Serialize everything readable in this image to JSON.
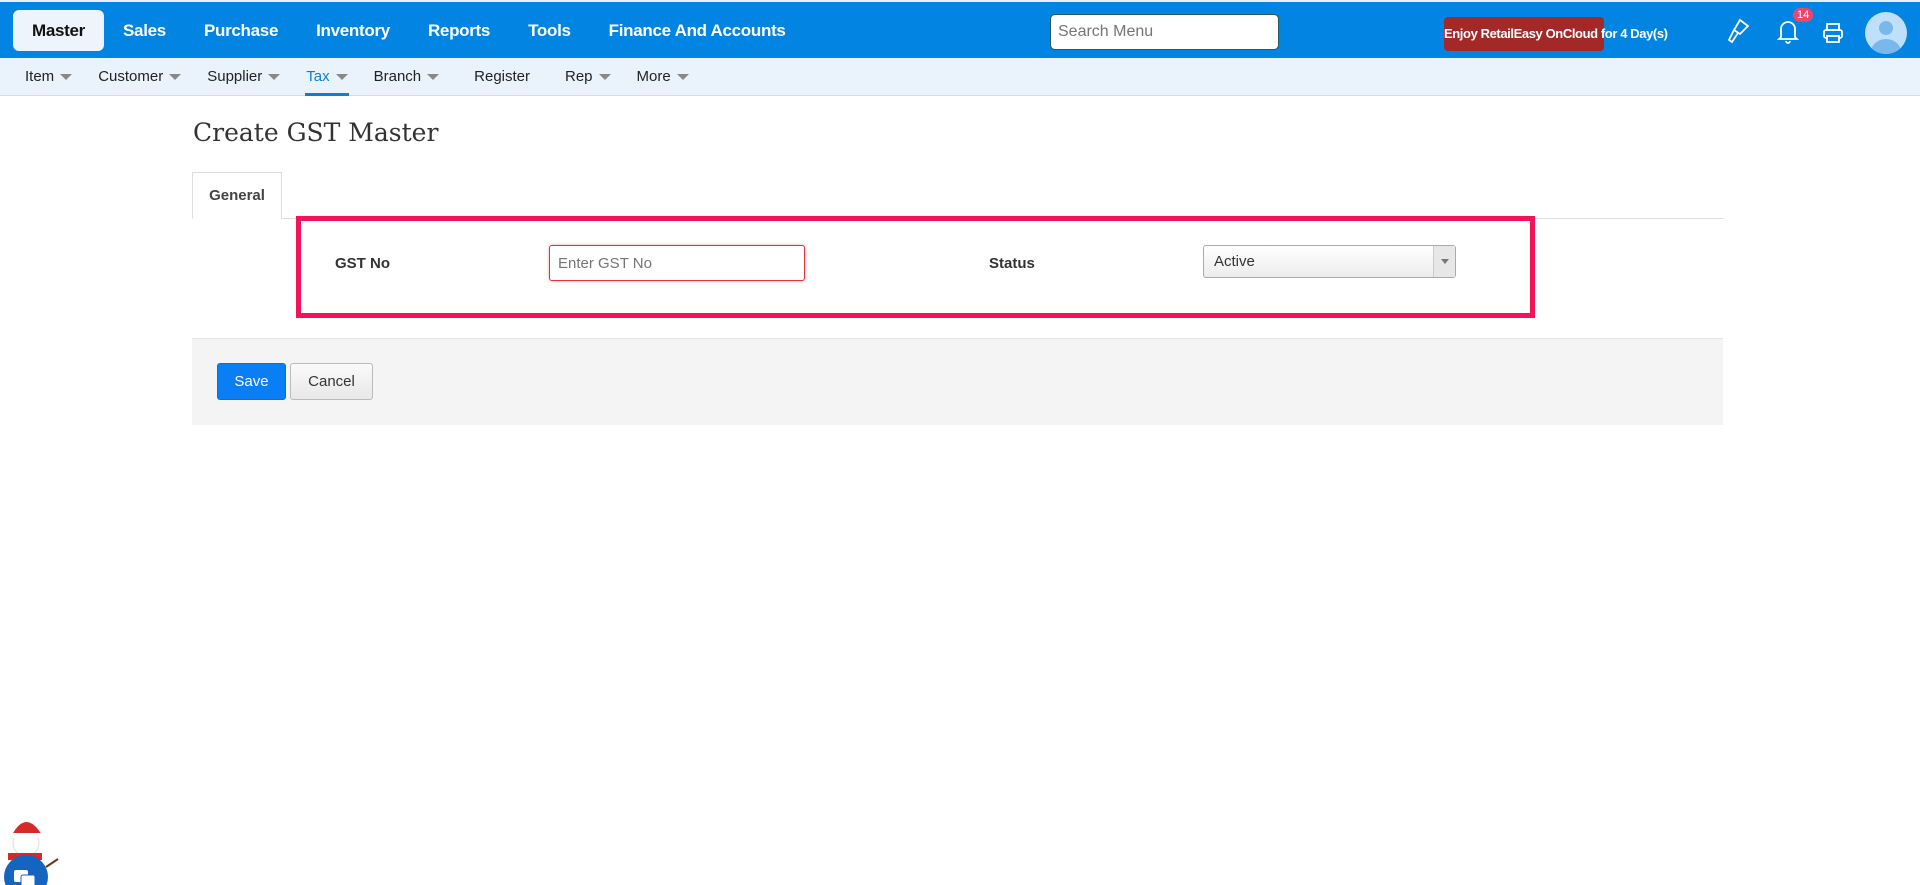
{
  "topbar": {
    "nav": [
      "Master",
      "Sales",
      "Purchase",
      "Inventory",
      "Reports",
      "Tools",
      "Finance And Accounts"
    ],
    "active_nav": "Master",
    "search_placeholder": "Search Menu",
    "promo": "Enjoy RetailEasy OnCloud for 4 Day(s)",
    "notification_count": "14",
    "colors": {
      "bar": "#0284e2",
      "promo": "#a32828"
    }
  },
  "subnav": {
    "items": [
      {
        "label": "Item",
        "caret": true
      },
      {
        "label": "Customer",
        "caret": true
      },
      {
        "label": "Supplier",
        "caret": true
      },
      {
        "label": "Tax",
        "caret": true
      },
      {
        "label": "Branch",
        "caret": true
      },
      {
        "label": "Register",
        "caret": false
      },
      {
        "label": "Rep",
        "caret": true
      },
      {
        "label": "More",
        "caret": true
      }
    ],
    "active": "Tax"
  },
  "page": {
    "title": "Create GST Master",
    "tab": "General",
    "gst_label": "GST No",
    "gst_placeholder": "Enter GST No",
    "status_label": "Status",
    "status_value": "Active",
    "save": "Save",
    "cancel": "Cancel"
  }
}
